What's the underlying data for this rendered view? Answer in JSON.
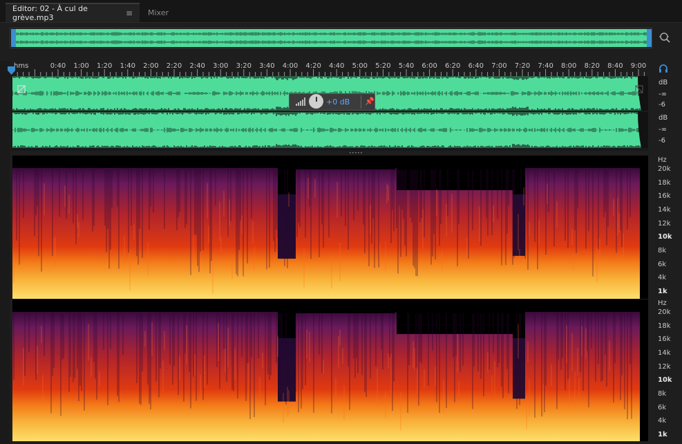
{
  "tabs": {
    "editor_label": "Editor: 02 - À cul de grève.mp3",
    "menu_icon": "≡",
    "mixer_label": "Mixer"
  },
  "ruler": {
    "unit_label": "hms",
    "ticks": [
      "0:40",
      "1:00",
      "1:20",
      "1:40",
      "2:00",
      "2:20",
      "2:40",
      "3:00",
      "3:20",
      "3:40",
      "4:00",
      "4:20",
      "4:40",
      "5:00",
      "5:20",
      "5:40",
      "6:00",
      "6:20",
      "6:40",
      "7:00",
      "7:20",
      "7:40",
      "8:00",
      "8:20",
      "8:40",
      "9:00"
    ]
  },
  "amplitude_scale": {
    "top": {
      "db": "dB",
      "inf": "-∞",
      "minus6": "-6"
    },
    "bottom": {
      "db": "dB",
      "inf": "-∞",
      "minus6": "-6"
    }
  },
  "hud": {
    "gain": "+0 dB",
    "pin_icon": "pin-icon"
  },
  "frequency_scale": {
    "unit": "Hz",
    "labels": [
      "20k",
      "18k",
      "16k",
      "14k",
      "12k",
      "10k",
      "8k",
      "6k",
      "4k",
      "1k"
    ],
    "bold": [
      "10k",
      "1k"
    ]
  },
  "colors": {
    "waveform": "#4fdc9b",
    "selection_handle": "#3b8fd1",
    "hud_value": "#5fa8ff"
  },
  "icons": {
    "zoom": "zoom-icon",
    "headphones": "headphones-icon",
    "playhead": "playhead-marker-icon"
  }
}
